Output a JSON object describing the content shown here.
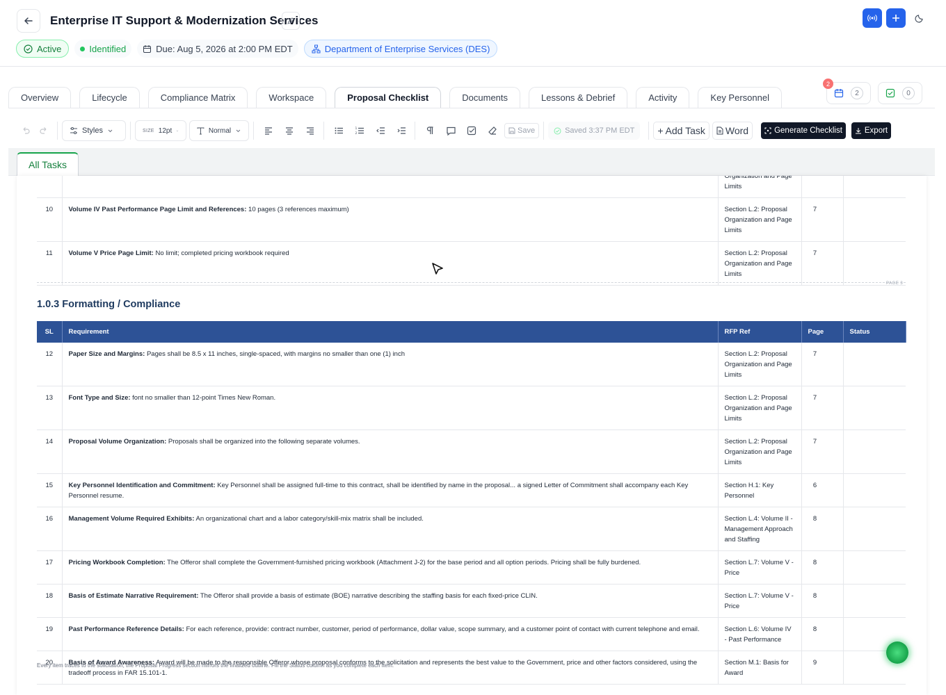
{
  "header": {
    "title": "Enterprise IT Support & Modernization Services",
    "status": "Active",
    "stage": "Identified",
    "due": "Due: Aug 5, 2026 at 2:00 PM EDT",
    "department": "Department of Enterprise Services (DES)"
  },
  "tabs": [
    "Overview",
    "Lifecycle",
    "Compliance Matrix",
    "Workspace",
    "Proposal Checklist",
    "Documents",
    "Lessons & Debrief",
    "Activity",
    "Key Personnel"
  ],
  "widgets": {
    "calendar_count": "2",
    "calendar_notif": "2",
    "tasks_count": "0"
  },
  "toolbar": {
    "styles": "Styles",
    "size_label": "SIZE",
    "size": "12pt",
    "font_style": "Normal",
    "save": "Save",
    "saved": "Saved 3:37 PM EDT",
    "add_task": "Add Task",
    "word": "Word",
    "generate": "Generate Checklist",
    "export": "Export"
  },
  "subtab": "All Tasks",
  "document": {
    "top_rows": [
      {
        "sl": "",
        "req_bold": "",
        "req_text": "",
        "ref": "Organization and Page Limits",
        "page": ""
      },
      {
        "sl": "10",
        "req_bold": "Volume IV Past Performance Page Limit and References:",
        "req_text": " 10 pages (3 references maximum)",
        "ref": "Section L.2: Proposal Organization and Page Limits",
        "page": "7"
      },
      {
        "sl": "11",
        "req_bold": "Volume V Price Page Limit:",
        "req_text": " No limit; completed pricing workbook required",
        "ref": "Section L.2: Proposal Organization and Page Limits",
        "page": "7"
      }
    ],
    "page_label": "PAGE 3",
    "section_title": "1.0.3 Formatting / Compliance",
    "columns": [
      "SL",
      "Requirement",
      "RFP Ref",
      "Page",
      "Status"
    ],
    "rows": [
      {
        "sl": "12",
        "req_bold": "Paper Size and Margins:",
        "req_text": " Pages shall be 8.5 x 11 inches, single-spaced, with margins no smaller than one (1) inch",
        "ref": "Section L.2: Proposal Organization and Page Limits",
        "page": "7"
      },
      {
        "sl": "13",
        "req_bold": "Font Type and Size:",
        "req_text": " font no smaller than 12-point Times New Roman.",
        "ref": "Section L.2: Proposal Organization and Page Limits",
        "page": "7"
      },
      {
        "sl": "14",
        "req_bold": "Proposal Volume Organization:",
        "req_text": " Proposals shall be organized into the following separate volumes.",
        "ref": "Section L.2: Proposal Organization and Page Limits",
        "page": "7"
      },
      {
        "sl": "15",
        "req_bold": "Key Personnel Identification and Commitment:",
        "req_text": " Key Personnel shall be assigned full-time to this contract, shall be identified by name in the proposal... a signed Letter of Commitment shall accompany each Key Personnel resume.",
        "ref": "Section H.1: Key Personnel",
        "page": "6"
      },
      {
        "sl": "16",
        "req_bold": "Management Volume Required Exhibits:",
        "req_text": " An organizational chart and a labor category/skill-mix matrix shall be included.",
        "ref": "Section L.4: Volume II - Management Approach and Staffing",
        "page": "8"
      },
      {
        "sl": "17",
        "req_bold": "Pricing Workbook Completion:",
        "req_text": " The Offeror shall complete the Government-furnished pricing workbook (Attachment J-2) for the base period and all option periods. Pricing shall be fully burdened.",
        "ref": "Section L.7: Volume V - Price",
        "page": "8"
      },
      {
        "sl": "18",
        "req_bold": "Basis of Estimate Narrative Requirement:",
        "req_text": " The Offeror shall provide a basis of estimate (BOE) narrative describing the staffing basis for each fixed-price CLIN.",
        "ref": "Section L.7: Volume V - Price",
        "page": "8"
      },
      {
        "sl": "19",
        "req_bold": "Past Performance Reference Details:",
        "req_text": " For each reference, provide: contract number, customer, period of performance, dollar value, scope summary, and a customer point of contact with current telephone and email.",
        "ref": "Section L.6: Volume IV - Past Performance",
        "page": "8"
      },
      {
        "sl": "20",
        "req_bold": "Basis of Award Awareness:",
        "req_text": " Award will be made to the responsible Offeror whose proposal conforms to the solicitation and represents the best value to the Government, price and other factors considered, using the tradeoff process in FAR 15.101-1.",
        "ref": "Section M.1: Basis for Award",
        "page": "9"
      }
    ],
    "footnote": "Every item traces to the solicitation; the Proposal Progress section mirrors the finalized outline. Fill the Status column as you complete each item."
  },
  "colors": {
    "accent": "#2563eb",
    "table_header": "#2d5296",
    "active": "#16a34a"
  }
}
